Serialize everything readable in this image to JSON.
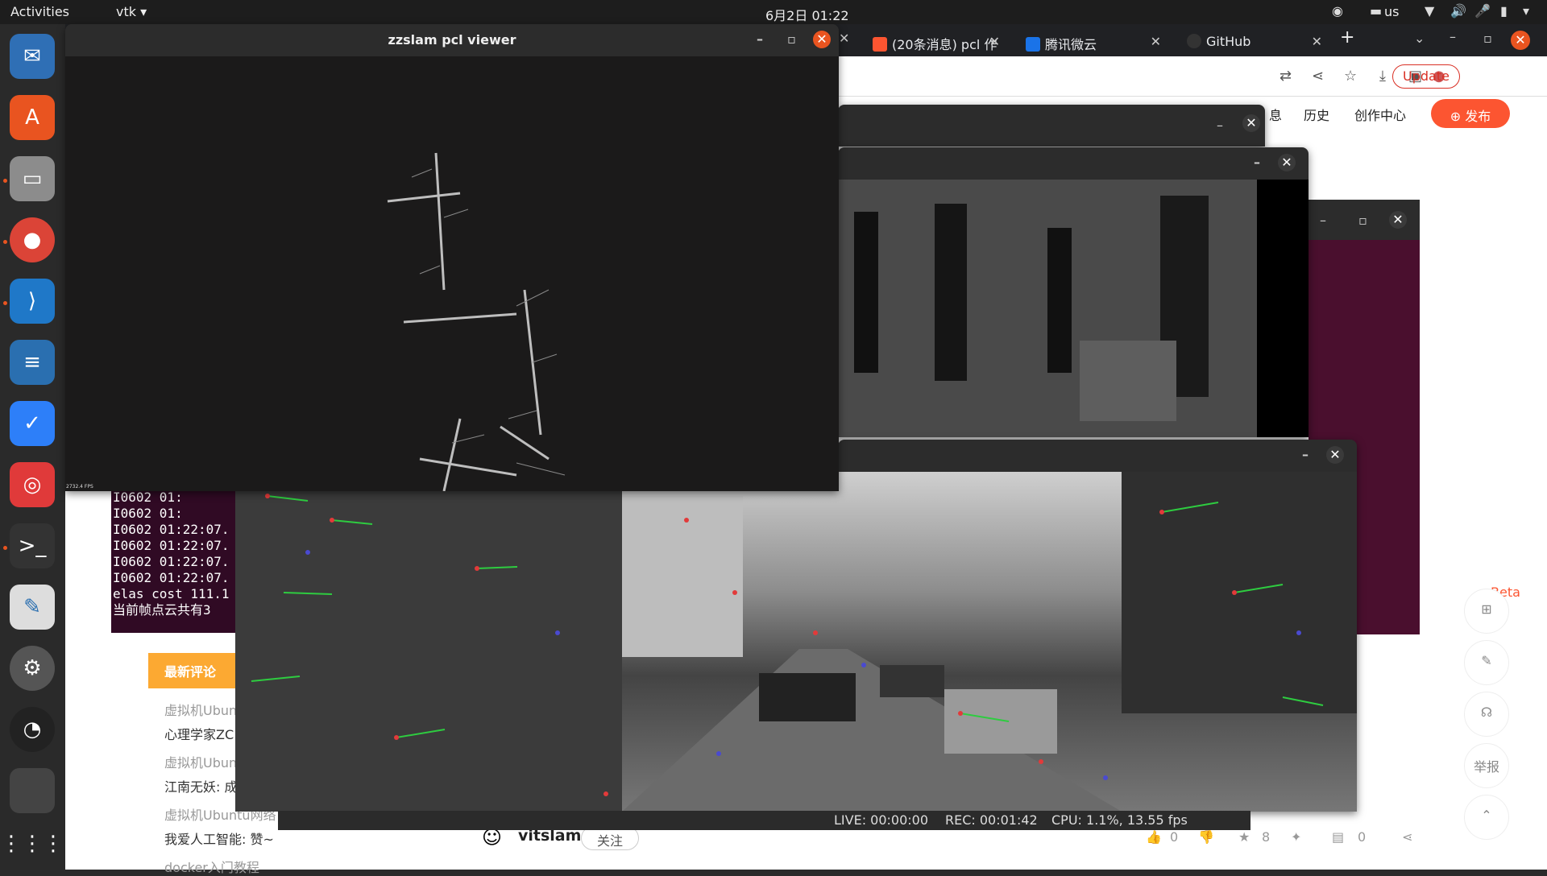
{
  "topbar": {
    "activities": "Activities",
    "app_menu": "vtk ▾",
    "clock": "6月2日  01:22",
    "keyboard": "us"
  },
  "tabs": [
    {
      "label": "(20条消息) pcl 作",
      "favicon_color": "#fc5531"
    },
    {
      "label": "腾讯微云",
      "favicon_color": "#1a73e8"
    },
    {
      "label": "GitHub",
      "favicon_color": "#333333"
    }
  ],
  "toolbar": {
    "update_label": "Update"
  },
  "csdn_header": {
    "link_partial": "息",
    "history": "历史",
    "creator_center": "创作中心",
    "publish": "发布"
  },
  "comments": {
    "header": "最新评论",
    "items": [
      {
        "title": "虚拟机Ubun",
        "content": "心理学家ZC"
      },
      {
        "title": "虚拟机Ubun",
        "content": "江南无妖: 成"
      },
      {
        "title": "虚拟机Ubuntu网络",
        "content": "我爱人工智能: 赞~"
      },
      {
        "title": "docker入门教程",
        "content": ""
      }
    ]
  },
  "author": {
    "name": "vitslam",
    "follow": "关注",
    "likes": "0",
    "stars": "8",
    "comments": "0"
  },
  "right_tools": {
    "beta": "Beta",
    "report": "举报"
  },
  "pcl_viewer": {
    "title": "zzslam pcl viewer",
    "fps_label": "2732.4 FPS"
  },
  "terminal": {
    "lines": [
      "I0602 01:",
      "I0602 01:",
      "I0602 01:22:07.",
      "I0602 01:22:07.",
      "I0602 01:22:07.",
      "I0602 01:22:07.",
      "elas cost 111.1",
      "当前帧点云共有3"
    ]
  },
  "recording": {
    "live": "LIVE: 00:00:00",
    "rec": "REC: 00:01:42",
    "cpu": "CPU: 1.1%, 13.55 fps"
  },
  "colors": {
    "ubuntu_orange": "#e95420",
    "csdn_red": "#fc5531",
    "comment_orange": "#fca932",
    "terminal_bg": "#300a24"
  }
}
